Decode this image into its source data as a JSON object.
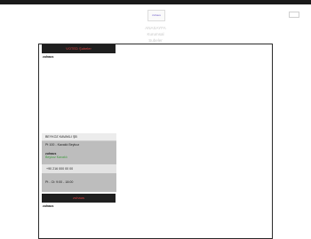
{
  "header": {
    "logo_text": "zuhaus",
    "nav": [
      "ANASAYFA",
      "Kurumsal",
      "Şubeler"
    ]
  },
  "panel_top": {
    "header": "VOTED Şubeler",
    "section_label": "zuhaus"
  },
  "info_card": {
    "title": "BEYKOZ KAVAKLI ŞB",
    "address": "Pt 100 - Kavaklı Beykoz",
    "shop_label": "zuhaus",
    "shop_sub": "Beykoz Kavaklı",
    "phone": "+90 216 000 00 00",
    "hours": "Pt - Ct: 9:00 - 18:00"
  },
  "panel_bottom": {
    "header": "zuhaus",
    "section_label": "zuhaus"
  }
}
